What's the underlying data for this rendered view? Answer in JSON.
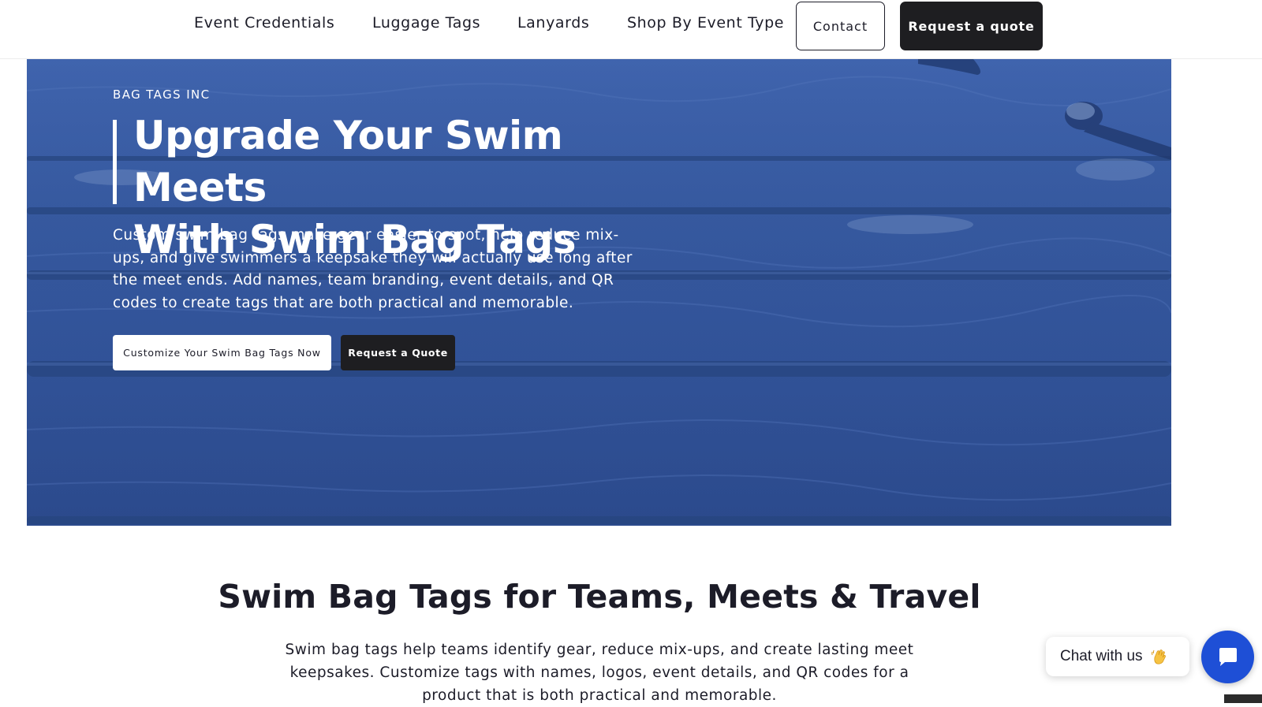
{
  "nav": {
    "links": [
      {
        "label": "Event Credentials"
      },
      {
        "label": "Luggage Tags"
      },
      {
        "label": "Lanyards"
      },
      {
        "label": "Shop By Event Type"
      }
    ],
    "contact_label": "Contact",
    "quote_label": "Request a quote"
  },
  "hero": {
    "eyebrow": "BAG TAGS INC",
    "title_line1": "Upgrade Your Swim Meets",
    "title_line2": "With Swim Bag Tags",
    "body": "Custom swim bag tags make gear easier to spot, help reduce mix-ups, and give swimmers a keepsake they will actually use long after the meet ends. Add names, team branding, event details, and QR codes to create tags that are both practical and memorable.",
    "primary_cta": "Customize Your Swim Bag Tags Now",
    "secondary_cta": "Request a Quote",
    "overlay_color": "#3a5ea8"
  },
  "section": {
    "title": "Swim Bag Tags for Teams, Meets & Travel",
    "body": "Swim bag tags help teams identify gear, reduce mix-ups, and create lasting meet keepsakes. Customize tags with names, logos, event details, and QR codes for a product that is both practical and memorable."
  },
  "chat": {
    "label": "Chat with us",
    "emoji_icon": "waving-hand-icon",
    "launcher_icon": "chat-icon",
    "launcher_color": "#1e4fd6"
  }
}
